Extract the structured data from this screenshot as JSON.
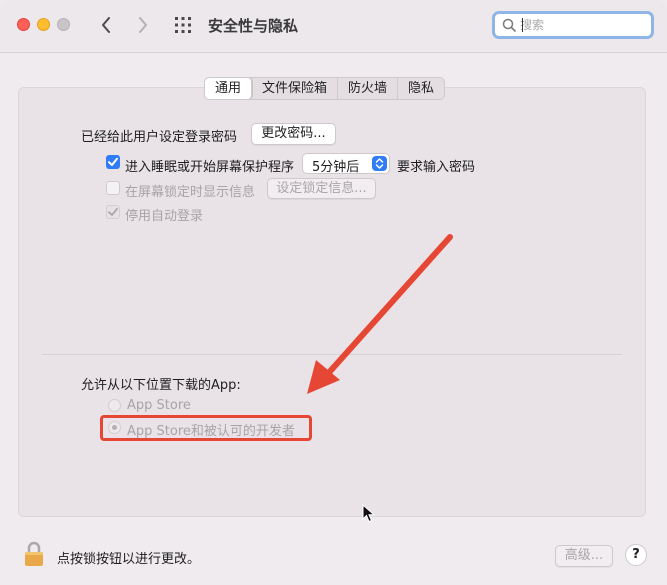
{
  "window": {
    "title": "安全性与隐私"
  },
  "search": {
    "placeholder": "搜索"
  },
  "tabs": [
    {
      "label": "通用",
      "active": true
    },
    {
      "label": "文件保险箱",
      "active": false
    },
    {
      "label": "防火墙",
      "active": false
    },
    {
      "label": "隐私",
      "active": false
    }
  ],
  "general": {
    "password_set_label": "已经给此用户设定登录密码",
    "change_password_button": "更改密码...",
    "require_password": {
      "checked": true,
      "label": "进入睡眠或开始屏幕保护程序",
      "delay_value": "5分钟后",
      "suffix": "要求输入密码"
    },
    "show_message": {
      "checked": false,
      "label": "在屏幕锁定时显示信息",
      "button": "设定锁定信息..."
    },
    "disable_auto_login": {
      "checked": true,
      "label": "停用自动登录"
    }
  },
  "downloads": {
    "heading": "允许从以下位置下载的App:",
    "options": [
      {
        "label": "App Store",
        "selected": false
      },
      {
        "label": "App Store和被认可的开发者",
        "selected": true
      }
    ]
  },
  "footer": {
    "lock_text": "点按锁按钮以进行更改。",
    "advanced_button": "高级...",
    "help_button": "?"
  },
  "colors": {
    "accent": "#2f7cf6",
    "annotation": "#e64734"
  }
}
